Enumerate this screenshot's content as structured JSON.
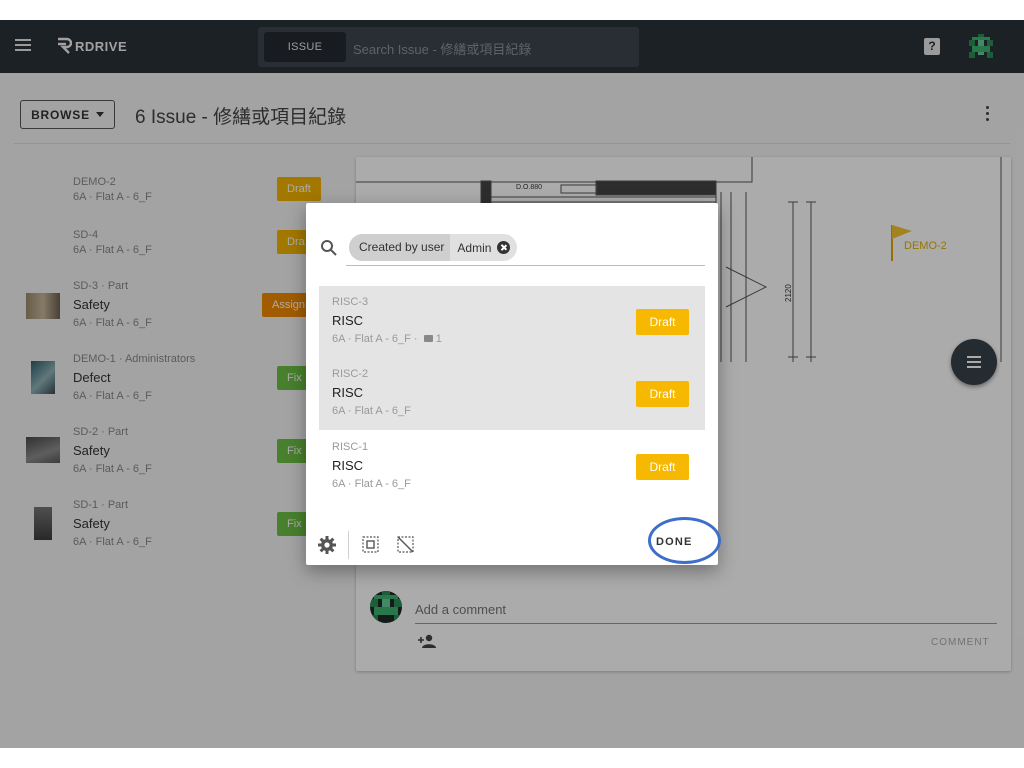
{
  "app": {
    "brand": "RDRIVE",
    "search_scope": "ISSUE",
    "search_placeholder": "Search Issue - 修繕或項目紀錄",
    "help_label": "?",
    "icons": [
      "menu-icon",
      "logo-icon",
      "help-icon",
      "avatar"
    ]
  },
  "toolbar": {
    "browse_label": "BROWSE",
    "page_title": "6 Issue - 修繕或項目紀錄"
  },
  "issues": [
    {
      "code": "DEMO-2",
      "title": "",
      "location": "6A · Flat A - 6_F",
      "status": "Draft"
    },
    {
      "code": "SD-4",
      "title": "",
      "location": "6A · Flat A - 6_F",
      "status": "Dra"
    },
    {
      "code": "SD-3 · Part",
      "title": "Safety",
      "location": "6A · Flat A - 6_F",
      "status": "Assign"
    },
    {
      "code": "DEMO-1 · Administrators",
      "title": "Defect",
      "location": "6A · Flat A - 6_F",
      "status": "Fix"
    },
    {
      "code": "SD-2 · Part",
      "title": "Safety",
      "location": "6A · Flat A - 6_F",
      "status": "Fix"
    },
    {
      "code": "SD-1 · Part",
      "title": "Safety",
      "location": "6A · Flat A - 6_F",
      "status": "Fix"
    }
  ],
  "drawing": {
    "door_label": "D.O.880",
    "dimension": "2120",
    "flag_label": "DEMO-2"
  },
  "comments": {
    "placeholder": "Add a comment",
    "button": "COMMENT"
  },
  "modal": {
    "filter_chip_key": "Created by user",
    "filter_chip_value": "Admin",
    "items": [
      {
        "code": "RISC-3",
        "title": "RISC",
        "location": "6A · Flat A - 6_F · ",
        "attachments": "1",
        "status": "Draft",
        "selected": true
      },
      {
        "code": "RISC-2",
        "title": "RISC",
        "location": "6A · Flat A - 6_F",
        "status": "Draft",
        "selected": true
      },
      {
        "code": "RISC-1",
        "title": "RISC",
        "location": "6A · Flat A - 6_F",
        "status": "Draft",
        "selected": false
      }
    ],
    "done_label": "DONE"
  },
  "colors": {
    "topbar": "#2b323a",
    "draft": "#f4b400",
    "assign": "#f08a00",
    "fixed": "#6cbf45",
    "highlight_ring": "#3d6ec9"
  }
}
